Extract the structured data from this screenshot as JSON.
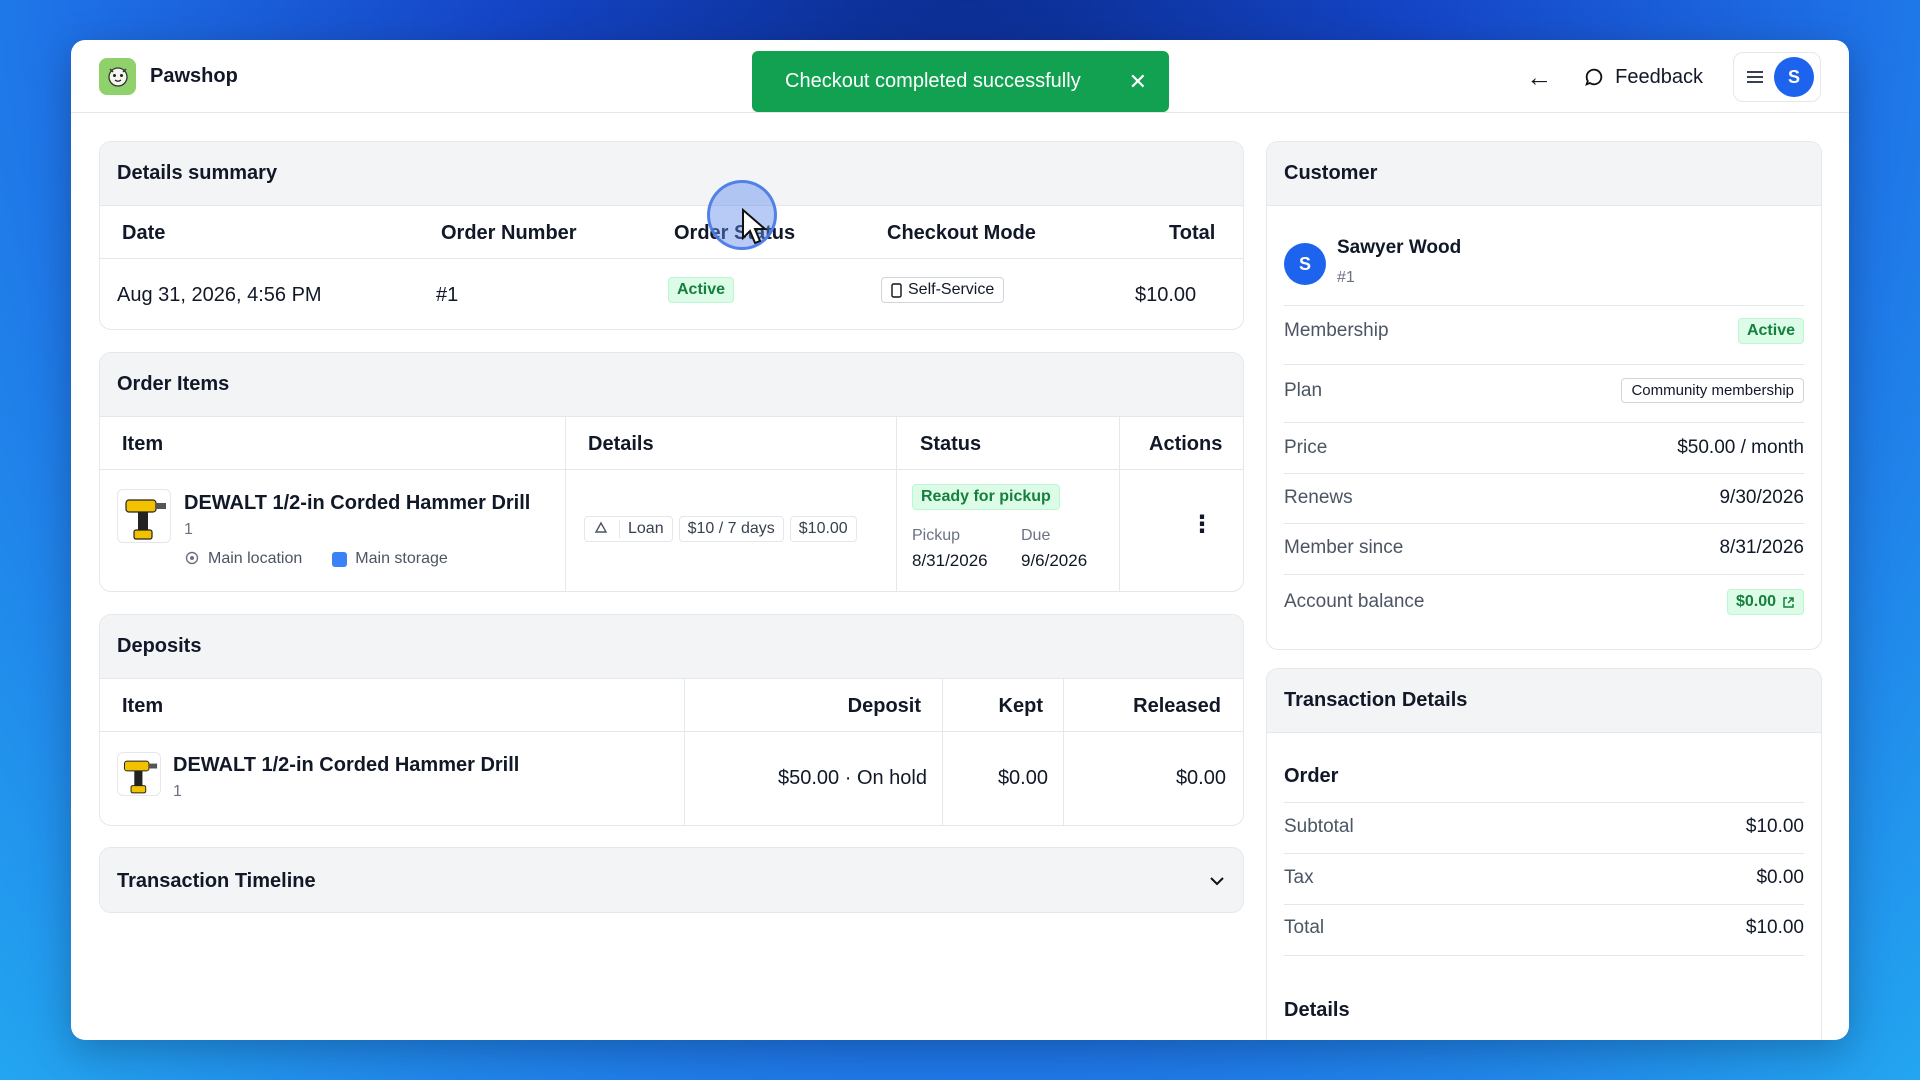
{
  "app": {
    "name": "Pawshop"
  },
  "toast": {
    "message": "Checkout completed successfully"
  },
  "topbar": {
    "feedback_label": "Feedback",
    "avatar_initial": "S"
  },
  "details_summary": {
    "title": "Details summary",
    "headers": [
      "Date",
      "Order Number",
      "Order Status",
      "Checkout Mode",
      "Total"
    ],
    "row": {
      "date": "Aug 31, 2026, 4:56 PM",
      "order_number": "#1",
      "status": "Active",
      "mode": "Self-Service",
      "total": "$10.00"
    }
  },
  "order_items": {
    "title": "Order Items",
    "headers": [
      "Item",
      "Details",
      "Status",
      "Actions"
    ],
    "item": {
      "name": "DEWALT 1/2-in Corded Hammer Drill",
      "qty": "1",
      "location": "Main location",
      "storage": "Main storage",
      "chips": [
        "Loan",
        "$10 / 7 days",
        "$10.00"
      ],
      "status": "Ready for pickup",
      "pickup_label": "Pickup",
      "pickup_date": "8/31/2026",
      "due_label": "Due",
      "due_date": "9/6/2026"
    }
  },
  "deposits": {
    "title": "Deposits",
    "headers": [
      "Item",
      "Deposit",
      "Kept",
      "Released"
    ],
    "row": {
      "name": "DEWALT 1/2-in Corded Hammer Drill",
      "qty": "1",
      "deposit": "$50.00 · On hold",
      "kept": "$0.00",
      "released": "$0.00"
    }
  },
  "timeline": {
    "title": "Transaction Timeline"
  },
  "customer": {
    "title": "Customer",
    "name": "Sawyer Wood",
    "id": "#1",
    "initial": "S",
    "rows": [
      {
        "label": "Membership",
        "value": "Active"
      },
      {
        "label": "Plan",
        "value": "Community membership"
      },
      {
        "label": "Price",
        "value": "$50.00 / month"
      },
      {
        "label": "Renews",
        "value": "9/30/2026"
      },
      {
        "label": "Member since",
        "value": "8/31/2026"
      },
      {
        "label": "Account balance",
        "value": "$0.00"
      }
    ]
  },
  "transaction": {
    "title": "Transaction Details",
    "order_heading": "Order",
    "rows": [
      {
        "label": "Subtotal",
        "value": "$10.00"
      },
      {
        "label": "Tax",
        "value": "$0.00"
      },
      {
        "label": "Total",
        "value": "$10.00"
      }
    ],
    "details_heading": "Details"
  },
  "colors": {
    "accent": "#1d63ed",
    "success": "#12a150"
  }
}
